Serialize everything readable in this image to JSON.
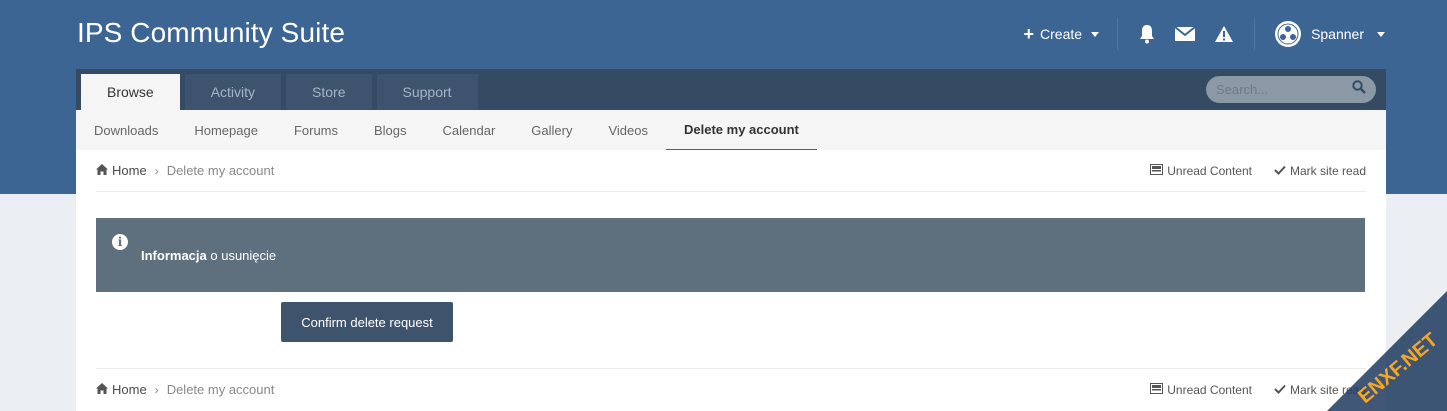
{
  "site": {
    "title": "IPS Community Suite"
  },
  "userbar": {
    "create_label": "Create",
    "username": "Spanner"
  },
  "nav": {
    "tabs": [
      {
        "label": "Browse",
        "active": true
      },
      {
        "label": "Activity",
        "active": false
      },
      {
        "label": "Store",
        "active": false
      },
      {
        "label": "Support",
        "active": false
      }
    ],
    "search_placeholder": "Search..."
  },
  "subnav": {
    "items": [
      {
        "label": "Downloads"
      },
      {
        "label": "Homepage"
      },
      {
        "label": "Forums"
      },
      {
        "label": "Blogs"
      },
      {
        "label": "Calendar"
      },
      {
        "label": "Gallery"
      },
      {
        "label": "Videos"
      },
      {
        "label": "Delete my account",
        "active": true
      }
    ]
  },
  "breadcrumb": {
    "home": "Home",
    "current": "Delete my account"
  },
  "actions": {
    "unread": "Unread Content",
    "mark_read": "Mark site read"
  },
  "info": {
    "title": "Informacja",
    "text": "o usunięcie"
  },
  "confirm_button": "Confirm delete request",
  "watermark": {
    "text": "ENXF.NET"
  },
  "colors": {
    "header": "#3d6594",
    "navbar": "#354b64",
    "info_box": "#5e707e",
    "button": "#3e546c"
  }
}
